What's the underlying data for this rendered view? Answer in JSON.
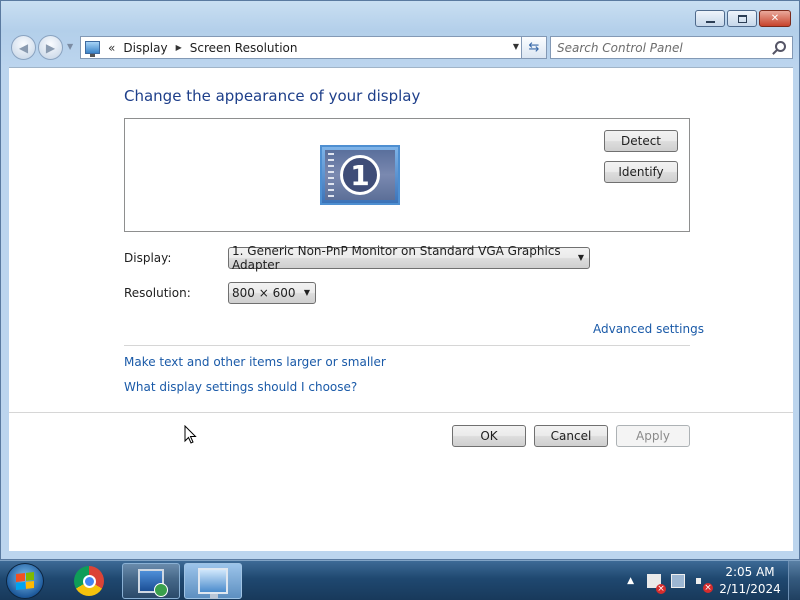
{
  "window": {
    "minimize_label": "",
    "maximize_label": "",
    "close_label": "✕"
  },
  "navbar": {
    "breadcrumb_overflow": "«",
    "breadcrumb": [
      "Display",
      "Screen Resolution"
    ],
    "search_placeholder": "Search Control Panel"
  },
  "main": {
    "title": "Change the appearance of your display",
    "monitor_number": "1",
    "detect_label": "Detect",
    "identify_label": "Identify",
    "display_label": "Display:",
    "display_value": "1. Generic Non-PnP Monitor on Standard VGA Graphics Adapter",
    "resolution_label": "Resolution:",
    "resolution_value": "800 × 600",
    "advanced_link": "Advanced settings",
    "link_text_size": "Make text and other items larger or smaller",
    "link_help": "What display settings should I choose?",
    "ok_label": "OK",
    "cancel_label": "Cancel",
    "apply_label": "Apply",
    "apply_enabled": false
  },
  "taskbar": {
    "items": [
      {
        "icon": "chrome-icon"
      },
      {
        "icon": "remote-desktop-icon"
      },
      {
        "icon": "control-panel-icon"
      }
    ],
    "tray": {
      "time": "2:05 AM",
      "date": "2/11/2024"
    }
  },
  "colors": {
    "link": "#1a5aa8",
    "title": "#1e3f8a",
    "taskbar": "#1f4870"
  }
}
